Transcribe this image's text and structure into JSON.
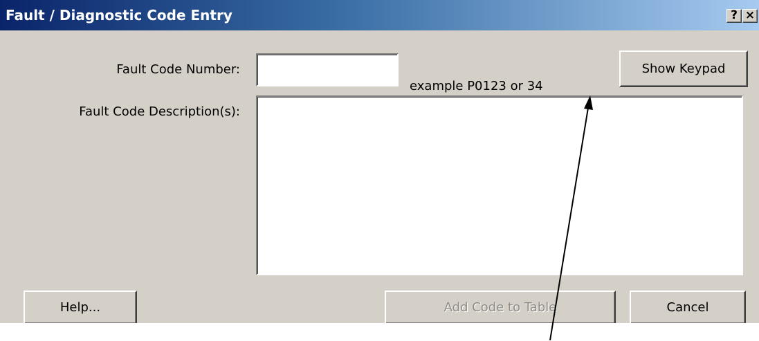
{
  "window": {
    "title": "Fault / Diagnostic Code Entry",
    "help_glyph": "?",
    "close_glyph": "×"
  },
  "form": {
    "code_label": "Fault Code Number:",
    "code_value": "",
    "example_text": "example P0123 or 34",
    "description_label": "Fault Code Description(s):",
    "description_value": ""
  },
  "buttons": {
    "show_keypad": "Show Keypad",
    "help": "Help...",
    "add_code": "Add Code to Table",
    "cancel": "Cancel"
  },
  "annotation": {
    "type": "arrow",
    "color": "#000000",
    "points_to": "example-hint"
  }
}
